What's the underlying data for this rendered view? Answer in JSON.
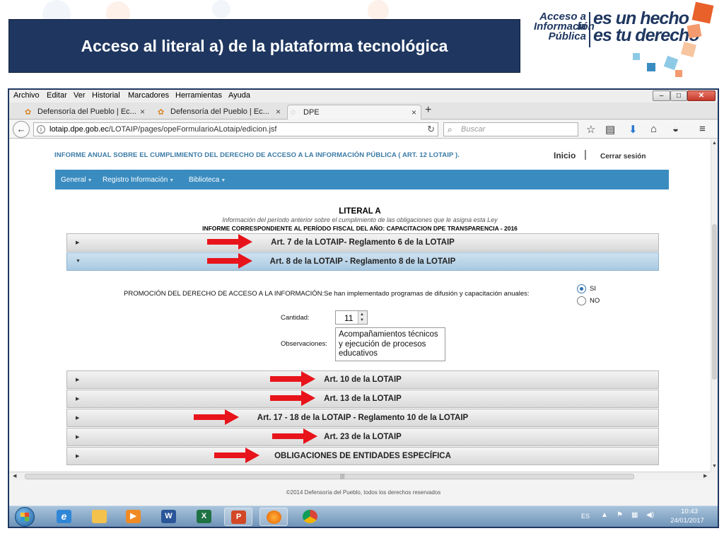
{
  "slide": {
    "title": "Acceso al literal a) de la plataforma tecnológica"
  },
  "logo": {
    "line1": "Acceso a la",
    "line2": "Información",
    "line3": "Pública",
    "slogan1": "es un hecho",
    "slogan2": "es tu derecho",
    "colors": [
      "#e8612a",
      "#f39b6f",
      "#8ecae6",
      "#3a8cc0",
      "#f7c59f"
    ]
  },
  "browser": {
    "menu": [
      "Archivo",
      "Editar",
      "Ver",
      "Historial",
      "Marcadores",
      "Herramientas",
      "Ayuda"
    ],
    "tabs": [
      {
        "label": "Defensoría del Pueblo | Ec...",
        "icon": "app-logo-icon"
      },
      {
        "label": "Defensoría del Pueblo | Ec...",
        "icon": "app-logo-icon"
      },
      {
        "label": "DPE",
        "icon": "loading-icon"
      }
    ],
    "url_domain": "lotaip.dpe.gob.ec",
    "url_path": "/LOTAIP/pages/opeFormularioALotaip/edicion.jsf",
    "search_placeholder": "Buscar"
  },
  "header": {
    "report_heading": "INFORME ANUAL SOBRE EL CUMPLIMIENTO DEL DERECHO DE ACCESO A LA INFORMACIÓN PÚBLICA ( ART. 12 LOTAIP ).",
    "home": "Inicio",
    "separator": "|",
    "logout": "Cerrar sesión"
  },
  "nav": [
    {
      "label": "General"
    },
    {
      "label": "Registro Información"
    },
    {
      "label": "Biblioteca"
    }
  ],
  "literal": {
    "title": "LITERAL A",
    "subtitle": "Información del período anterior sobre el cumplimiento de las obligaciones que le asigna esta Ley",
    "report": "INFORME CORRESPONDIENTE AL PERÍODO FISCAL DEL AÑO: CAPACITACION DPE TRANSPARENCIA - 2016"
  },
  "sections": [
    {
      "label": "Art. 7 de la LOTAIP- Reglamento 6 de la LOTAIP",
      "expanded": false
    },
    {
      "label": "Art. 8 de la LOTAIP - Reglamento 8 de la LOTAIP",
      "expanded": true
    },
    {
      "label": "Art. 10 de la LOTAIP",
      "expanded": false
    },
    {
      "label": "Art. 13 de la LOTAIP",
      "expanded": false
    },
    {
      "label": "Art. 17 - 18 de la LOTAIP - Reglamento 10 de la LOTAIP",
      "expanded": false
    },
    {
      "label": "Art. 23 de la LOTAIP",
      "expanded": false
    },
    {
      "label": "OBLIGACIONES DE ENTIDADES ESPECÍFICA",
      "expanded": false
    }
  ],
  "form": {
    "promo_question": "PROMOCIÓN DEL DERECHO DE ACCESO A LA INFORMACIÓN:Se han implementado programas de difusión y capacitación anuales:",
    "option_yes": "SI",
    "option_no": "NO",
    "selected": "SI",
    "quantity_label": "Cantidad:",
    "quantity": "11",
    "observations_label": "Observaciones:",
    "observations": "Acompañamientos técnicos y ejecución de procesos educativos"
  },
  "footer": {
    "text": "©2014 Defensoría del Pueblo, todos los derechos reservados"
  },
  "taskbar": {
    "language": "ES",
    "time": "10:43",
    "date": "24/01/2017"
  },
  "colors": {
    "slide_title_bg": "#1f3760",
    "nav_bg": "#3a8cc0",
    "heading_text": "#3a7aa6",
    "arrow": "#e8141b",
    "section_expanded_bg": "#a9c9e2"
  }
}
